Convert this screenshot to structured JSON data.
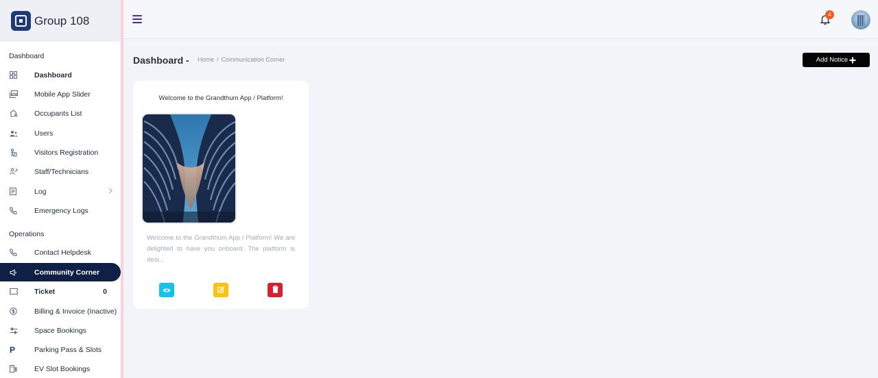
{
  "brand": {
    "name": "Group 108"
  },
  "sidebar": {
    "sections": [
      {
        "label": "Dashboard",
        "items": [
          {
            "label": "Dashboard",
            "icon": "grid-icon",
            "bold": true
          },
          {
            "label": "Mobile App Slider",
            "icon": "images-icon"
          },
          {
            "label": "Occupants List",
            "icon": "home-user-icon"
          },
          {
            "label": "Users",
            "icon": "users-icon"
          },
          {
            "label": "Visitors Registration",
            "icon": "visitor-icon"
          },
          {
            "label": "Staff/Technicians",
            "icon": "staff-icon"
          },
          {
            "label": "Log",
            "icon": "log-icon",
            "has_submenu": true
          },
          {
            "label": "Emergency Logs",
            "icon": "phone-icon"
          }
        ]
      },
      {
        "label": "Operations",
        "items": [
          {
            "label": "Contact Helpdesk",
            "icon": "phone-icon"
          },
          {
            "label": "Community Corner",
            "icon": "megaphone-icon",
            "active": true
          },
          {
            "label": "Ticket",
            "icon": "ticket-icon",
            "bold": true,
            "count": "0"
          },
          {
            "label": "Billing & Invoice (Inactive)",
            "icon": "dollar-circle-icon"
          },
          {
            "label": "Space Bookings",
            "icon": "sliders-icon"
          },
          {
            "label": "Parking Pass & Slots",
            "icon": "parking-icon",
            "glyph": "P"
          },
          {
            "label": "EV Slot Bookings",
            "icon": "ev-charger-icon"
          }
        ]
      }
    ]
  },
  "topbar": {
    "notification_count": "4"
  },
  "header": {
    "title": "Dashboard -",
    "breadcrumb": {
      "home": "Home",
      "separator": "/",
      "current": "Communication Corner"
    },
    "add_notice_label": "Add Notice"
  },
  "notice_card": {
    "title": "Welcome to the Grandthum App / Platform!",
    "description": "Welcome to the Grandthum App / Platform! We are delighted to have you onboard. The platform is desi..."
  },
  "colors": {
    "sidebar_active": "#0f1f45",
    "brand": "#1c3b78",
    "view_button": "#12c3ec",
    "edit_button": "#fec10f",
    "delete_button": "#d8212f",
    "notification_badge": "#f55a1b"
  }
}
